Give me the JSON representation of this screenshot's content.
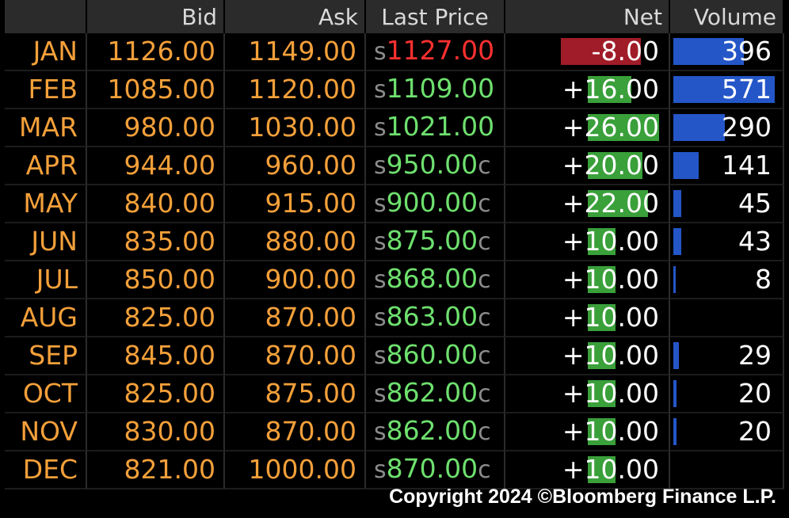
{
  "headers": {
    "month": "",
    "bid": "Bid",
    "ask": "Ask",
    "last": "Last Price",
    "net": "Net",
    "volume": "Volume"
  },
  "colors": {
    "header_bg": "#2b2b2b",
    "label_orange": "#f4a03a",
    "price_up_green": "#6ee06e",
    "price_down_red": "#ff3030",
    "net_bar_green": "#3aa03a",
    "net_bar_red": "#a01c28",
    "volume_bar_blue": "#2456c8"
  },
  "price_prefix": "s",
  "rows": [
    {
      "month": "JAN",
      "bid": "1126.00",
      "ask": "1149.00",
      "last": "1127.00",
      "last_suffix": "",
      "direction": "down",
      "net": "-8.00",
      "net_value": -8.0,
      "volume": "396",
      "volume_value": 396
    },
    {
      "month": "FEB",
      "bid": "1085.00",
      "ask": "1120.00",
      "last": "1109.00",
      "last_suffix": "",
      "direction": "up",
      "net": "+16.00",
      "net_value": 16.0,
      "volume": "571",
      "volume_value": 571
    },
    {
      "month": "MAR",
      "bid": "980.00",
      "ask": "1030.00",
      "last": "1021.00",
      "last_suffix": "",
      "direction": "up",
      "net": "+26.00",
      "net_value": 26.0,
      "volume": "290",
      "volume_value": 290
    },
    {
      "month": "APR",
      "bid": "944.00",
      "ask": "960.00",
      "last": "950.00",
      "last_suffix": "c",
      "direction": "up",
      "net": "+20.00",
      "net_value": 20.0,
      "volume": "141",
      "volume_value": 141
    },
    {
      "month": "MAY",
      "bid": "840.00",
      "ask": "915.00",
      "last": "900.00",
      "last_suffix": "c",
      "direction": "up",
      "net": "+22.00",
      "net_value": 22.0,
      "volume": "45",
      "volume_value": 45
    },
    {
      "month": "JUN",
      "bid": "835.00",
      "ask": "880.00",
      "last": "875.00",
      "last_suffix": "c",
      "direction": "up",
      "net": "+10.00",
      "net_value": 10.0,
      "volume": "43",
      "volume_value": 43
    },
    {
      "month": "JUL",
      "bid": "850.00",
      "ask": "900.00",
      "last": "868.00",
      "last_suffix": "c",
      "direction": "up",
      "net": "+10.00",
      "net_value": 10.0,
      "volume": "8",
      "volume_value": 8
    },
    {
      "month": "AUG",
      "bid": "825.00",
      "ask": "870.00",
      "last": "863.00",
      "last_suffix": "c",
      "direction": "up",
      "net": "+10.00",
      "net_value": 10.0,
      "volume": "",
      "volume_value": 0
    },
    {
      "month": "SEP",
      "bid": "845.00",
      "ask": "870.00",
      "last": "860.00",
      "last_suffix": "c",
      "direction": "up",
      "net": "+10.00",
      "net_value": 10.0,
      "volume": "29",
      "volume_value": 29
    },
    {
      "month": "OCT",
      "bid": "825.00",
      "ask": "875.00",
      "last": "862.00",
      "last_suffix": "c",
      "direction": "up",
      "net": "+10.00",
      "net_value": 10.0,
      "volume": "20",
      "volume_value": 20
    },
    {
      "month": "NOV",
      "bid": "830.00",
      "ask": "870.00",
      "last": "862.00",
      "last_suffix": "c",
      "direction": "up",
      "net": "+10.00",
      "net_value": 10.0,
      "volume": "20",
      "volume_value": 20
    },
    {
      "month": "DEC",
      "bid": "821.00",
      "ask": "1000.00",
      "last": "870.00",
      "last_suffix": "c",
      "direction": "up",
      "net": "+10.00",
      "net_value": 10.0,
      "volume": "",
      "volume_value": 0
    }
  ],
  "footer": {
    "copyright": "Copyright 2024 ©Bloomberg Finance L.P."
  }
}
